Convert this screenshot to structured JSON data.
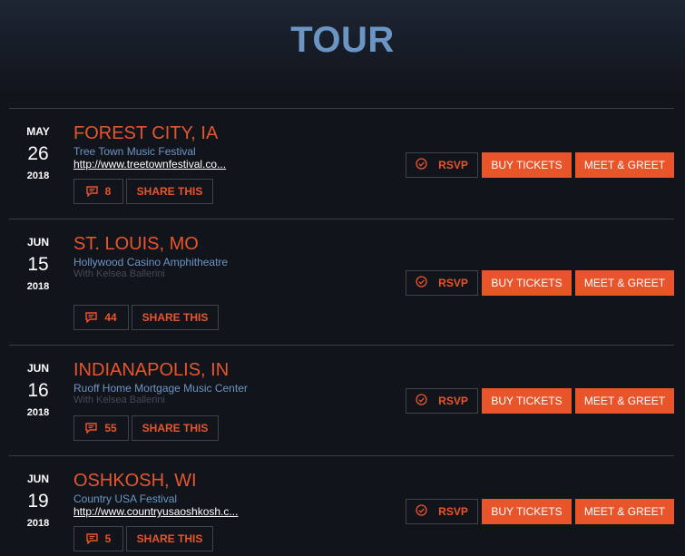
{
  "page": {
    "title": "TOUR"
  },
  "labels": {
    "rsvp": "RSVP",
    "buy": "BUY TICKETS",
    "meet": "MEET & GREET",
    "share": "SHARE THIS"
  },
  "colors": {
    "accent": "#e9552b",
    "title_blue": "#6b95c4",
    "background": "#12141b"
  },
  "events": [
    {
      "month": "MAY",
      "day": "26",
      "year": "2018",
      "city": "FOREST CITY, IA",
      "venue": "Tree Town Music Festival",
      "link": "http://www.treetownfestival.co...",
      "note": "",
      "comments": "8"
    },
    {
      "month": "JUN",
      "day": "15",
      "year": "2018",
      "city": "ST. LOUIS, MO",
      "venue": "Hollywood Casino Amphitheatre",
      "link": "",
      "note": "With Kelsea Ballerini",
      "comments": "44"
    },
    {
      "month": "JUN",
      "day": "16",
      "year": "2018",
      "city": "INDIANAPOLIS, IN",
      "venue": "Ruoff Home Mortgage Music Center",
      "link": "",
      "note": "With Kelsea Ballerini",
      "comments": "55"
    },
    {
      "month": "JUN",
      "day": "19",
      "year": "2018",
      "city": "OSHKOSH, WI",
      "venue": "Country USA Festival",
      "link": "http://www.countryusaoshkosh.c...",
      "note": "",
      "comments": "5"
    }
  ]
}
